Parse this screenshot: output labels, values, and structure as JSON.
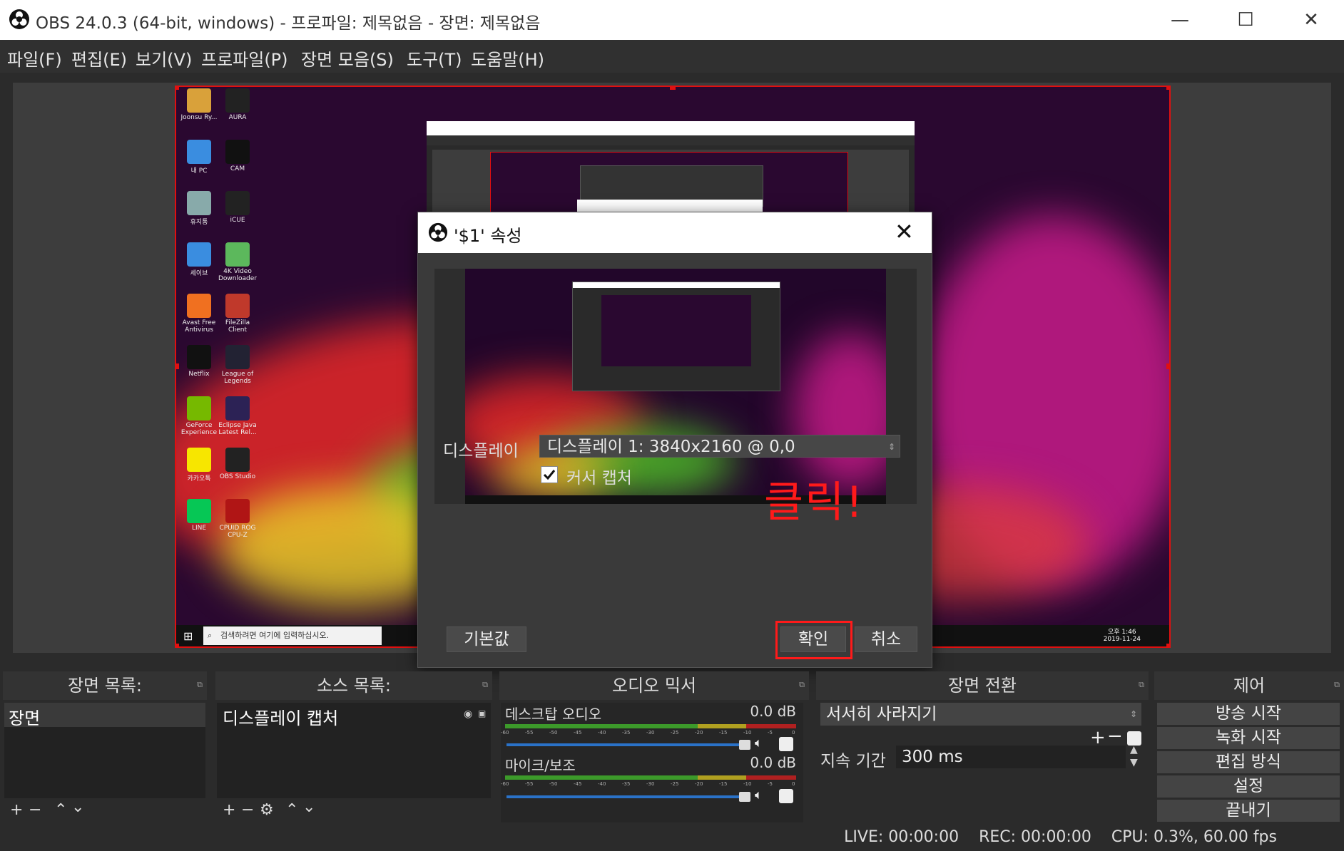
{
  "window": {
    "title": "OBS 24.0.3 (64-bit, windows) - 프로파일: 제목없음 - 장면: 제목없음",
    "minimize": "—",
    "maximize": "☐",
    "close": "✕"
  },
  "menu": [
    "파일(F)",
    "편집(E)",
    "보기(V)",
    "프로파일(P)",
    "장면 모음(S)",
    "도구(T)",
    "도움말(H)"
  ],
  "desktop_icons": [
    {
      "label": "Joonsu Ry...",
      "color": "#d9a13a"
    },
    {
      "label": "AURA",
      "color": "#222"
    },
    {
      "label": "내 PC",
      "color": "#3a8de0"
    },
    {
      "label": "CAM",
      "color": "#111"
    },
    {
      "label": "휴지통",
      "color": "#8aa"
    },
    {
      "label": "iCUE",
      "color": "#222"
    },
    {
      "label": "세이브",
      "color": "#3a8de0"
    },
    {
      "label": "4K Video Downloader",
      "color": "#5cb85c"
    },
    {
      "label": "Avast Free Antivirus",
      "color": "#f07020"
    },
    {
      "label": "FileZilla Client",
      "color": "#c0392b"
    },
    {
      "label": "Netflix",
      "color": "#111"
    },
    {
      "label": "League of Legends",
      "color": "#223"
    },
    {
      "label": "GeForce Experience",
      "color": "#76b900"
    },
    {
      "label": "Eclipse Java Latest Rel...",
      "color": "#2c2255"
    },
    {
      "label": "카카오톡",
      "color": "#f7e600"
    },
    {
      "label": "OBS Studio",
      "color": "#222"
    },
    {
      "label": "LINE",
      "color": "#06c755"
    },
    {
      "label": "CPUID ROG CPU-Z",
      "color": "#b01515"
    }
  ],
  "taskbar": {
    "search_placeholder": "검색하려면 여기에 입력하십시오.",
    "clock_time": "오후 1:46",
    "clock_date": "2019-11-24"
  },
  "dialog": {
    "title": "'$1' 속성",
    "display_label": "디스플레이",
    "display_value": "디스플레이 1: 3840x2160 @ 0,0",
    "cursor_capture_label": "커서 캡처",
    "cursor_capture_checked": true,
    "defaults_button": "기본값",
    "ok_button": "확인",
    "cancel_button": "취소",
    "annotation": "클릭!"
  },
  "docks": {
    "scenes": {
      "title": "장면 목록:",
      "items": [
        "장면"
      ]
    },
    "sources": {
      "title": "소스 목록:",
      "items": [
        "디스플레이 캡처"
      ]
    },
    "mixer": {
      "title": "오디오 믹서",
      "channels": [
        {
          "name": "데스크탑 오디오",
          "level": "0.0 dB"
        },
        {
          "name": "마이크/보조",
          "level": "0.0 dB"
        }
      ],
      "scale": [
        "-60",
        "-55",
        "-50",
        "-45",
        "-40",
        "-35",
        "-30",
        "-25",
        "-20",
        "-15",
        "-10",
        "-5",
        "0"
      ]
    },
    "transitions": {
      "title": "장면 전환",
      "selected": "서서히 사라지기",
      "duration_label": "지속 기간",
      "duration_value": "300 ms"
    },
    "controls": {
      "title": "제어",
      "buttons": [
        "방송 시작",
        "녹화 시작",
        "편집 방식",
        "설정",
        "끝내기"
      ]
    }
  },
  "status": {
    "live": "LIVE: 00:00:00",
    "rec": "REC: 00:00:00",
    "cpu": "CPU: 0.3%, 60.00 fps"
  },
  "colors": {
    "selection": "#e01010",
    "annotation": "#ff1a1a",
    "meter_green": "#3c9a2a",
    "meter_yellow": "#b0a020",
    "meter_red": "#b02020"
  }
}
